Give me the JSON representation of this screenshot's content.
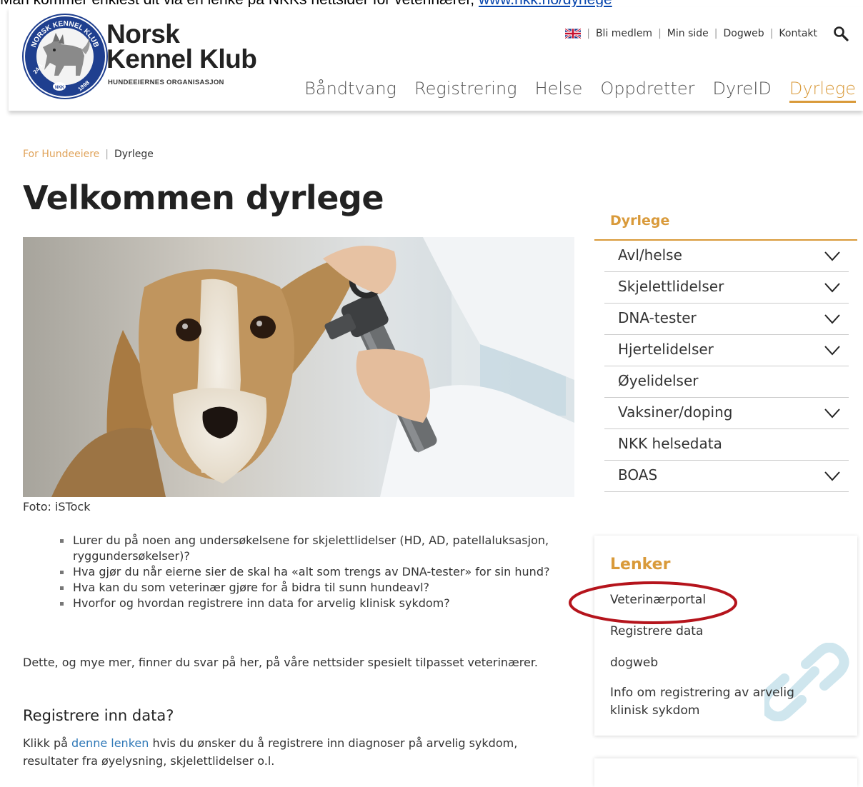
{
  "top_caption": {
    "text": "Man kommer enklest dit via en lenke på NKKs nettsider for veterinærer, ",
    "link": "www.nkk.no/dyrlege"
  },
  "header": {
    "logo_line1": "Norsk",
    "logo_line2": "Kennel Klub",
    "tagline": "HUNDEEIERNES ORGANISASJON",
    "seal_text_top": "NORSK KENNEL KLUB",
    "seal_text_bottom_left": "24-1",
    "seal_text_bottom_mid": "NKK",
    "seal_text_bottom_right": "1898",
    "util_links": [
      "Bli medlem",
      "Min side",
      "Dogweb",
      "Kontakt"
    ],
    "nav": [
      "Båndtvang",
      "Registrering",
      "Helse",
      "Oppdretter",
      "DyreID",
      "Dyrlege"
    ],
    "active_nav": "Dyrlege",
    "accent_color": "#d99a3a"
  },
  "breadcrumb": {
    "parent": "For Hundeeiere",
    "current": "Dyrlege"
  },
  "page_title": "Velkommen dyrlege",
  "hero": {
    "caption": "Foto: iSTock"
  },
  "bullets": [
    "Lurer du på noen ang undersøkelsene for skjelettlidelser (HD, AD, patellaluksasjon, ryggundersøkelser)?",
    "Hva gjør du når eierne sier de skal ha «alt som trengs av DNA-tester» for sin hund?",
    "Hva kan du som veterinær gjøre for å bidra til sunn hundeavl?",
    "Hvorfor og hvordan registrere inn data for arvelig klinisk sykdom?"
  ],
  "intro": "Dette, og mye mer, finner du svar på her, på våre nettsider spesielt tilpasset veterinærer.",
  "section": {
    "heading": "Registrere inn data?",
    "before_link": "Klikk på ",
    "link": "denne lenken",
    "after_link": " hvis du ønsker du å registrere inn diagnoser på arvelig sykdom, resultater fra øyelysning, skjelettlidelser o.l."
  },
  "sidebar": {
    "title": "Dyrlege",
    "items": [
      {
        "label": "Avl/helse",
        "expandable": true
      },
      {
        "label": "Skjelettlidelser",
        "expandable": true
      },
      {
        "label": "DNA-tester",
        "expandable": true
      },
      {
        "label": "Hjertelidelser",
        "expandable": true
      },
      {
        "label": "Øyelidelser",
        "expandable": false
      },
      {
        "label": "Vaksiner/doping",
        "expandable": true
      },
      {
        "label": "NKK helsedata",
        "expandable": false
      },
      {
        "label": "BOAS",
        "expandable": true
      }
    ]
  },
  "links_box": {
    "title": "Lenker",
    "items": [
      "Veterinærportal",
      "Registrere data",
      "dogweb",
      "Info om registrering av arvelig",
      "klinisk sykdom"
    ]
  }
}
